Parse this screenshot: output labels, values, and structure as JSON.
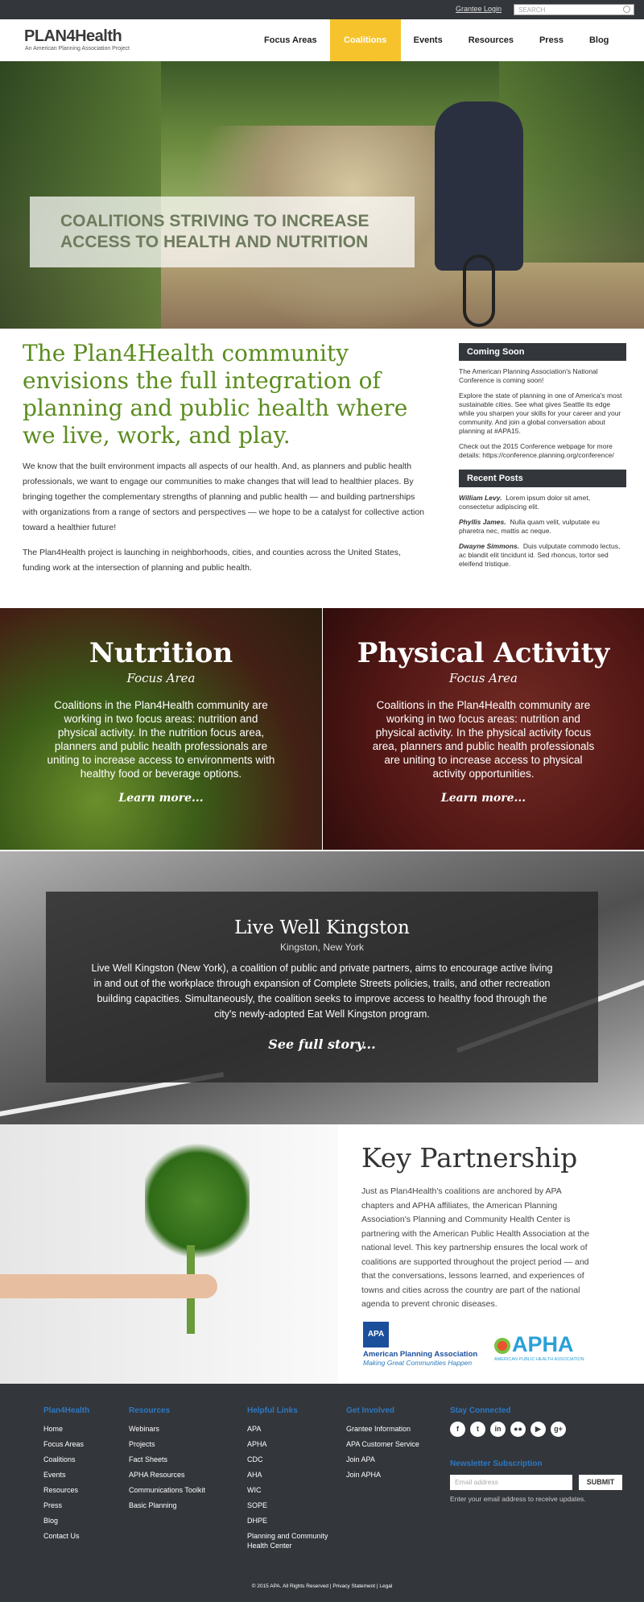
{
  "topbar": {
    "grantee_login": "Grantee Login",
    "search_placeholder": "SEARCH"
  },
  "header": {
    "logo_brand": "PLAN4Health",
    "logo_tagline": "An American Planning Association Project",
    "nav": [
      {
        "label": "Focus Areas",
        "active": false
      },
      {
        "label": "Coalitions",
        "active": true
      },
      {
        "label": "Events",
        "active": false
      },
      {
        "label": "Resources",
        "active": false
      },
      {
        "label": "Press",
        "active": false
      },
      {
        "label": "Blog",
        "active": false
      }
    ],
    "active_color": "#f7c32d"
  },
  "hero": {
    "line1": "COALITIONS STRIVING TO INCREASE",
    "line2": "ACCESS TO HEALTH AND NUTRITION"
  },
  "intro": {
    "heading": "The Plan4Health community envisions the full integration of planning and public health where we live, work, and play.",
    "p1": "We know that the built environment impacts all aspects of our health. And, as planners and public health professionals, we want to engage our communities to make changes that will lead to healthier places. By bringing together the complementary strengths of planning and public health — and building partnerships with organizations from a range of sectors and perspectives — we hope to be a catalyst for collective action toward a healthier future!",
    "p2": "The Plan4Health project is launching in neighborhoods, cities, and counties across the United States, funding work at the intersection of planning and public health.",
    "heading_color": "#5b8c1e"
  },
  "sidebar": {
    "coming_soon_title": "Coming Soon",
    "cs_p1": "The American Planning Association's National Conference is coming soon!",
    "cs_p2": "Explore the state of planning in one of America's most sustainable cities. See what gives Seattle its edge while you sharpen your skills for your career and your community. And join a global conversation about planning at #APA15.",
    "cs_p3": "Check out the 2015 Conference webpage for more details: https://conference.planning.org/conference/",
    "recent_posts_title": "Recent Posts",
    "posts": [
      {
        "author": "William Levy.",
        "text": "Lorem ipsum dolor sit amet, consectetur adipiscing elit."
      },
      {
        "author": "Phyllis James.",
        "text": "Nulla quam velit, vulputate eu pharetra nec, mattis ac neque."
      },
      {
        "author": "Dwayne Simmons.",
        "text": "Duis vulputate commodo lectus, ac blandit elit tincidunt id. Sed rhoncus, tortor sed eleifend tristique."
      }
    ]
  },
  "focus": {
    "nutrition": {
      "title": "Nutrition",
      "subtitle": "Focus Area",
      "text": "Coalitions in the Plan4Health community are working in two focus areas: nutrition and physical activity.  In the nutrition focus area, planners and public health professionals are uniting to increase access to environments with healthy food or beverage options.",
      "link": "Learn more..."
    },
    "physical": {
      "title": "Physical Activity",
      "subtitle": "Focus Area",
      "text": "Coalitions in the Plan4Health community are working in two focus areas: nutrition and physical activity. In the physical activity focus area, planners and public health professionals are uniting to increase access to physical activity opportunities.",
      "link": "Learn more..."
    }
  },
  "story": {
    "title": "Live Well Kingston",
    "location": "Kingston, New York",
    "text": "Live Well Kingston (New York), a coalition of public and private partners, aims to encourage active living in and out of the workplace through expansion of Complete Streets policies, trails, and other recreation building capacities. Simultaneously, the coalition seeks to improve access to healthy food through the city's newly-adopted Eat Well Kingston program.",
    "link": "See full story..."
  },
  "partnership": {
    "title": "Key Partnership",
    "text": "Just as Plan4Health's coalitions are anchored by APA chapters and APHA affiliates, the American Planning Association's Planning and Community Health Center is partnering with the American Public Health Association at the national level. This key partnership ensures the local work of coalitions are supported throughout the project period — and that the conversations, lessons learned, and experiences of towns and cities across the country are part of the national agenda to prevent chronic diseases.",
    "apa_mark": "APA",
    "apa_name": "American Planning Association",
    "apa_tagline": "Making Great Communities Happen",
    "apha_name": "APHA",
    "apha_sub": "AMERICAN PUBLIC HEALTH ASSOCIATION"
  },
  "footer": {
    "heading_color": "#2d78c2",
    "col1": {
      "title": "Plan4Health",
      "links": [
        "Home",
        "Focus Areas",
        "Coalitions",
        "Events",
        "Resources",
        "Press",
        "Blog",
        "Contact Us"
      ]
    },
    "col2": {
      "title": "Resources",
      "links": [
        "Webinars",
        "Projects",
        "Fact Sheets",
        "APHA Resources",
        "Communications Toolkit",
        "Basic Planning"
      ]
    },
    "col3": {
      "title": "Helpful Links",
      "links": [
        "APA",
        "APHA",
        "CDC",
        "AHA",
        "WIC",
        "SOPE",
        "DHPE",
        "Planning and Community Health Center"
      ]
    },
    "col4": {
      "title": "Get Involved",
      "links": [
        "Grantee Information",
        "APA Customer Service",
        "Join APA",
        "Join APHA"
      ]
    },
    "stay_connected": "Stay Connected",
    "newsletter_title": "Newsletter Subscription",
    "email_placeholder": "Email address",
    "submit": "SUBMIT",
    "newsletter_help": "Enter your email address to receive updates.",
    "copyright": "© 2015 APA. All Rights Reserved   |   Privacy Statement   |   Legal"
  }
}
